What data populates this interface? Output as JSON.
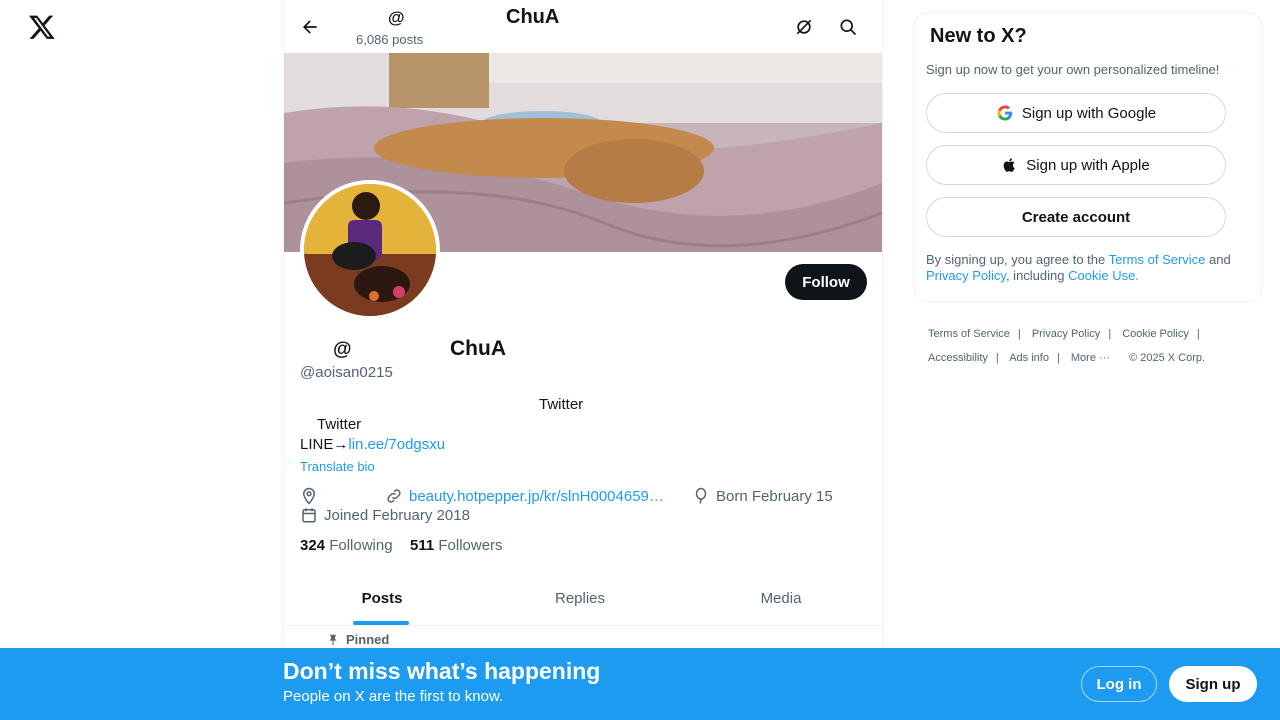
{
  "colors": {
    "accent": "#1d9bf0",
    "text": "#0f1419",
    "muted": "#536471"
  },
  "header": {
    "handle": "@",
    "post_count": "6,086 posts",
    "name": "ChuA"
  },
  "profile": {
    "display_at": "@",
    "display_name": "ChuA",
    "handle": "@aoisan0215",
    "follow_label": "Follow",
    "bio_line1": "Twitter",
    "bio_line2": "Twitter",
    "bio_line3_prefix": "LINE→",
    "bio_line3_link": "lin.ee/7odgsxu",
    "translate_label": "Translate bio",
    "website": "beauty.hotpepper.jp/kr/slnH0004659…",
    "born": "Born February 15",
    "joined": "Joined February 2018",
    "following_count": "324",
    "following_label": "Following",
    "followers_count": "511",
    "followers_label": "Followers"
  },
  "tabs": [
    {
      "label": "Posts",
      "active": true
    },
    {
      "label": "Replies",
      "active": false
    },
    {
      "label": "Media",
      "active": false
    }
  ],
  "pinned_label": "Pinned",
  "sidebar": {
    "title": "New to X?",
    "subtitle": "Sign up now to get your own personalized timeline!",
    "google_label": "Sign up with Google",
    "apple_label": "Sign up with Apple",
    "create_label": "Create account",
    "terms_prefix": "By signing up, you agree to the ",
    "terms_link": "Terms of Service",
    "terms_and": " and ",
    "privacy_link": "Privacy Policy",
    "terms_including": ", including ",
    "cookie_link": "Cookie Use."
  },
  "footer": {
    "links": [
      "Terms of Service",
      "Privacy Policy",
      "Cookie Policy",
      "Accessibility",
      "Ads info",
      "More ···"
    ],
    "copyright": "© 2025 X Corp."
  },
  "bottom_bar": {
    "title": "Don’t miss what’s happening",
    "subtitle": "People on X are the first to know.",
    "login_label": "Log in",
    "signup_label": "Sign up"
  },
  "icons": [
    "x-logo-icon",
    "back-arrow-icon",
    "grok-icon",
    "search-icon",
    "location-icon",
    "link-icon",
    "balloon-icon",
    "calendar-icon",
    "pin-icon",
    "google-icon",
    "apple-icon"
  ]
}
